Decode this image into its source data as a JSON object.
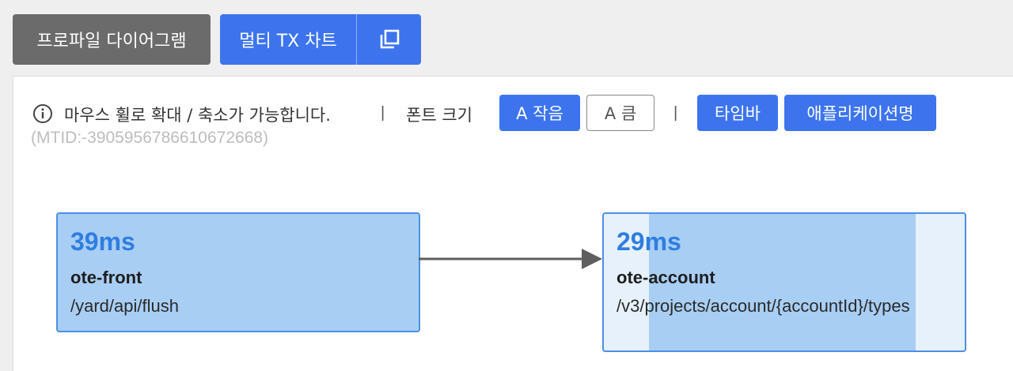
{
  "top_bar": {
    "profile_diagram_label": "프로파일 다이어그램",
    "multi_tx_chart_label": "멀티 TX 차트",
    "copy_icon": "copy-icon"
  },
  "toolbar": {
    "hint": "마우스 휠로 확대 / 축소가 가능합니다.",
    "separator": "|",
    "font_size_label": "폰트 크기",
    "font_small": "A 작음",
    "font_large": "A 큼",
    "timebar": "타임바",
    "app_name": "애플리케이션명",
    "info_icon": "info-icon"
  },
  "mtid": "(MTID:-3905956786610672668)",
  "nodes": [
    {
      "ms": "39ms",
      "service": "ote-front",
      "path": "/yard/api/flush",
      "fill_fraction": 1.0
    },
    {
      "ms": "29ms",
      "service": "ote-account",
      "path": "/v3/projects/account/{accountId}/types",
      "fill_start_fraction": 0.125,
      "fill_fraction": 0.74
    }
  ],
  "colors": {
    "primary": "#3d74ee",
    "secondary_button": "#6b6b6b",
    "node_border": "#4d8fe6",
    "node_fill": "#a8cef4",
    "ms_text": "#2f7ee0"
  }
}
